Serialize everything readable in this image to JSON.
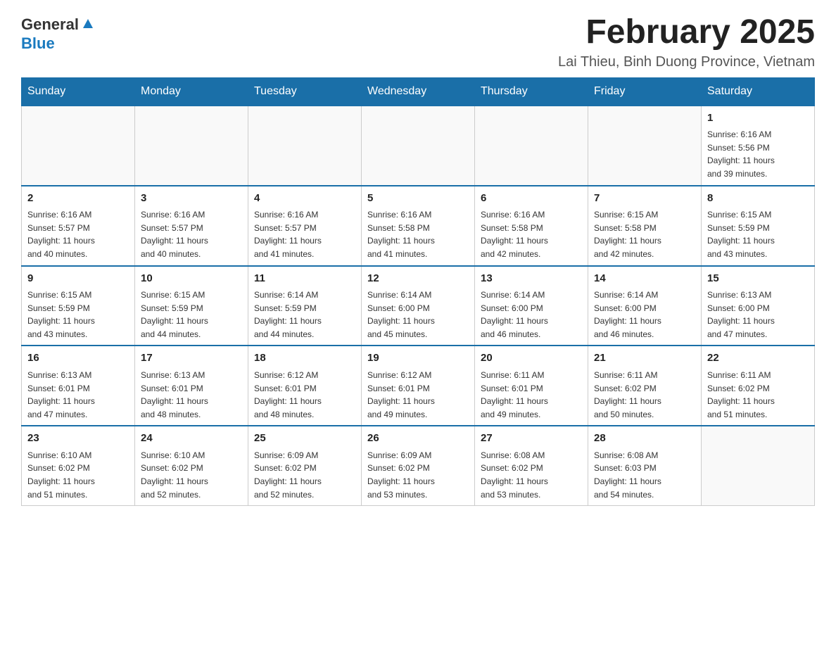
{
  "header": {
    "logo": {
      "general": "General",
      "blue": "Blue"
    },
    "title": "February 2025",
    "location": "Lai Thieu, Binh Duong Province, Vietnam"
  },
  "days_of_week": [
    "Sunday",
    "Monday",
    "Tuesday",
    "Wednesday",
    "Thursday",
    "Friday",
    "Saturday"
  ],
  "weeks": [
    [
      {
        "day": "",
        "info": ""
      },
      {
        "day": "",
        "info": ""
      },
      {
        "day": "",
        "info": ""
      },
      {
        "day": "",
        "info": ""
      },
      {
        "day": "",
        "info": ""
      },
      {
        "day": "",
        "info": ""
      },
      {
        "day": "1",
        "info": "Sunrise: 6:16 AM\nSunset: 5:56 PM\nDaylight: 11 hours\nand 39 minutes."
      }
    ],
    [
      {
        "day": "2",
        "info": "Sunrise: 6:16 AM\nSunset: 5:57 PM\nDaylight: 11 hours\nand 40 minutes."
      },
      {
        "day": "3",
        "info": "Sunrise: 6:16 AM\nSunset: 5:57 PM\nDaylight: 11 hours\nand 40 minutes."
      },
      {
        "day": "4",
        "info": "Sunrise: 6:16 AM\nSunset: 5:57 PM\nDaylight: 11 hours\nand 41 minutes."
      },
      {
        "day": "5",
        "info": "Sunrise: 6:16 AM\nSunset: 5:58 PM\nDaylight: 11 hours\nand 41 minutes."
      },
      {
        "day": "6",
        "info": "Sunrise: 6:16 AM\nSunset: 5:58 PM\nDaylight: 11 hours\nand 42 minutes."
      },
      {
        "day": "7",
        "info": "Sunrise: 6:15 AM\nSunset: 5:58 PM\nDaylight: 11 hours\nand 42 minutes."
      },
      {
        "day": "8",
        "info": "Sunrise: 6:15 AM\nSunset: 5:59 PM\nDaylight: 11 hours\nand 43 minutes."
      }
    ],
    [
      {
        "day": "9",
        "info": "Sunrise: 6:15 AM\nSunset: 5:59 PM\nDaylight: 11 hours\nand 43 minutes."
      },
      {
        "day": "10",
        "info": "Sunrise: 6:15 AM\nSunset: 5:59 PM\nDaylight: 11 hours\nand 44 minutes."
      },
      {
        "day": "11",
        "info": "Sunrise: 6:14 AM\nSunset: 5:59 PM\nDaylight: 11 hours\nand 44 minutes."
      },
      {
        "day": "12",
        "info": "Sunrise: 6:14 AM\nSunset: 6:00 PM\nDaylight: 11 hours\nand 45 minutes."
      },
      {
        "day": "13",
        "info": "Sunrise: 6:14 AM\nSunset: 6:00 PM\nDaylight: 11 hours\nand 46 minutes."
      },
      {
        "day": "14",
        "info": "Sunrise: 6:14 AM\nSunset: 6:00 PM\nDaylight: 11 hours\nand 46 minutes."
      },
      {
        "day": "15",
        "info": "Sunrise: 6:13 AM\nSunset: 6:00 PM\nDaylight: 11 hours\nand 47 minutes."
      }
    ],
    [
      {
        "day": "16",
        "info": "Sunrise: 6:13 AM\nSunset: 6:01 PM\nDaylight: 11 hours\nand 47 minutes."
      },
      {
        "day": "17",
        "info": "Sunrise: 6:13 AM\nSunset: 6:01 PM\nDaylight: 11 hours\nand 48 minutes."
      },
      {
        "day": "18",
        "info": "Sunrise: 6:12 AM\nSunset: 6:01 PM\nDaylight: 11 hours\nand 48 minutes."
      },
      {
        "day": "19",
        "info": "Sunrise: 6:12 AM\nSunset: 6:01 PM\nDaylight: 11 hours\nand 49 minutes."
      },
      {
        "day": "20",
        "info": "Sunrise: 6:11 AM\nSunset: 6:01 PM\nDaylight: 11 hours\nand 49 minutes."
      },
      {
        "day": "21",
        "info": "Sunrise: 6:11 AM\nSunset: 6:02 PM\nDaylight: 11 hours\nand 50 minutes."
      },
      {
        "day": "22",
        "info": "Sunrise: 6:11 AM\nSunset: 6:02 PM\nDaylight: 11 hours\nand 51 minutes."
      }
    ],
    [
      {
        "day": "23",
        "info": "Sunrise: 6:10 AM\nSunset: 6:02 PM\nDaylight: 11 hours\nand 51 minutes."
      },
      {
        "day": "24",
        "info": "Sunrise: 6:10 AM\nSunset: 6:02 PM\nDaylight: 11 hours\nand 52 minutes."
      },
      {
        "day": "25",
        "info": "Sunrise: 6:09 AM\nSunset: 6:02 PM\nDaylight: 11 hours\nand 52 minutes."
      },
      {
        "day": "26",
        "info": "Sunrise: 6:09 AM\nSunset: 6:02 PM\nDaylight: 11 hours\nand 53 minutes."
      },
      {
        "day": "27",
        "info": "Sunrise: 6:08 AM\nSunset: 6:02 PM\nDaylight: 11 hours\nand 53 minutes."
      },
      {
        "day": "28",
        "info": "Sunrise: 6:08 AM\nSunset: 6:03 PM\nDaylight: 11 hours\nand 54 minutes."
      },
      {
        "day": "",
        "info": ""
      }
    ]
  ]
}
